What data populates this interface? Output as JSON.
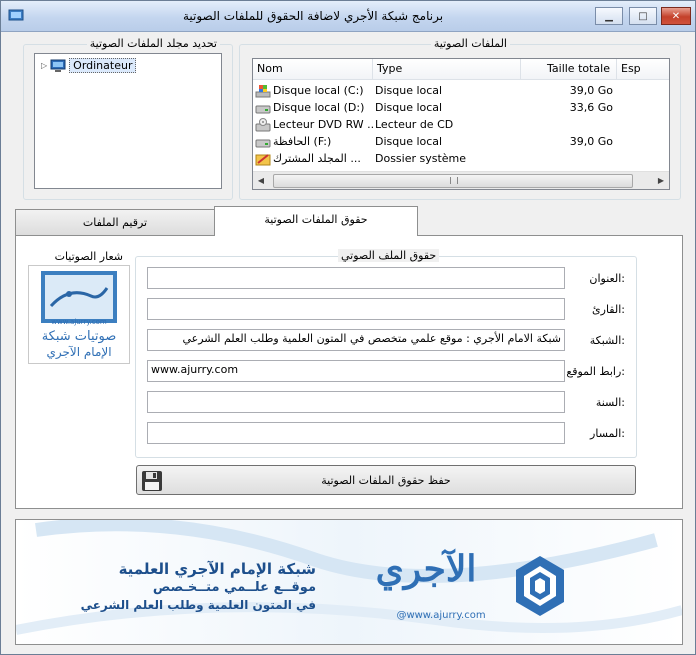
{
  "window": {
    "title": "برنامج شبكة الأجري لاضافة الحقوق للملفات الصوتية",
    "controls": {
      "minimize": "▁",
      "maximize": "□",
      "close": "✕"
    }
  },
  "folder_group": {
    "title": "تحديد مجلد الملفات الصوتية",
    "tree_root": "Ordinateur"
  },
  "files_group": {
    "title": "الملفات الصوتية",
    "columns": [
      "Nom",
      "Type",
      "Taille totale",
      "Esp"
    ],
    "rows": [
      {
        "name": "Disque local (C:)",
        "type": "Disque local",
        "size": "39,0 Go",
        "icon": "windows-drive-icon"
      },
      {
        "name": "Disque local (D:)",
        "type": "Disque local",
        "size": "33,6 Go",
        "icon": "hard-drive-icon"
      },
      {
        "name": "Lecteur DVD RW ...",
        "type": "Lecteur de CD",
        "size": "",
        "icon": "dvd-drive-icon"
      },
      {
        "name": "الحافظة (F:)",
        "type": "Disque local",
        "size": "39,0 Go",
        "icon": "hard-drive-icon"
      },
      {
        "name": "المجلد المشترك ...",
        "type": "Dossier système",
        "size": "",
        "icon": "shared-folder-icon"
      }
    ]
  },
  "tabs": {
    "numbering": "ترقيم الملفات",
    "rights": "حقوق الملفات الصوتية"
  },
  "logo_box": {
    "title": "شعار الصوتيات",
    "url": "www.ajurry.com",
    "caption_line1": "صوتيات شبكة",
    "caption_line2": "الإمام الآجري"
  },
  "rights_group": {
    "title": "حقوق الملف الصوتي",
    "fields": {
      "title_label": "العنوان:",
      "title_value": "",
      "reciter_label": "القارئ:",
      "reciter_value": "",
      "network_label": "الشبكة:",
      "network_value": "شبكة  الامام الأجري : موقع علمي متخصص في المتون العلمية وطلب العلم الشرعي",
      "url_label": "رابط الموقع:",
      "url_value": "www.ajurry.com",
      "year_label": "السنة:",
      "year_value": "",
      "path_label": "المسار:",
      "path_value": ""
    },
    "save_button": "حفظ حقوق الملفات الصوتية"
  },
  "banner": {
    "line1": "شبكة الإمام الآجري العلمية",
    "line2": "موقــع علــمي متــخـصص",
    "line3": "في المتون العلمية وطلب العلم الشرعي",
    "logo_text": "الآجري",
    "url": "@www.ajurry.com"
  },
  "colors": {
    "accent": "#2f6fb5",
    "banner_text": "#1d4f8c"
  }
}
